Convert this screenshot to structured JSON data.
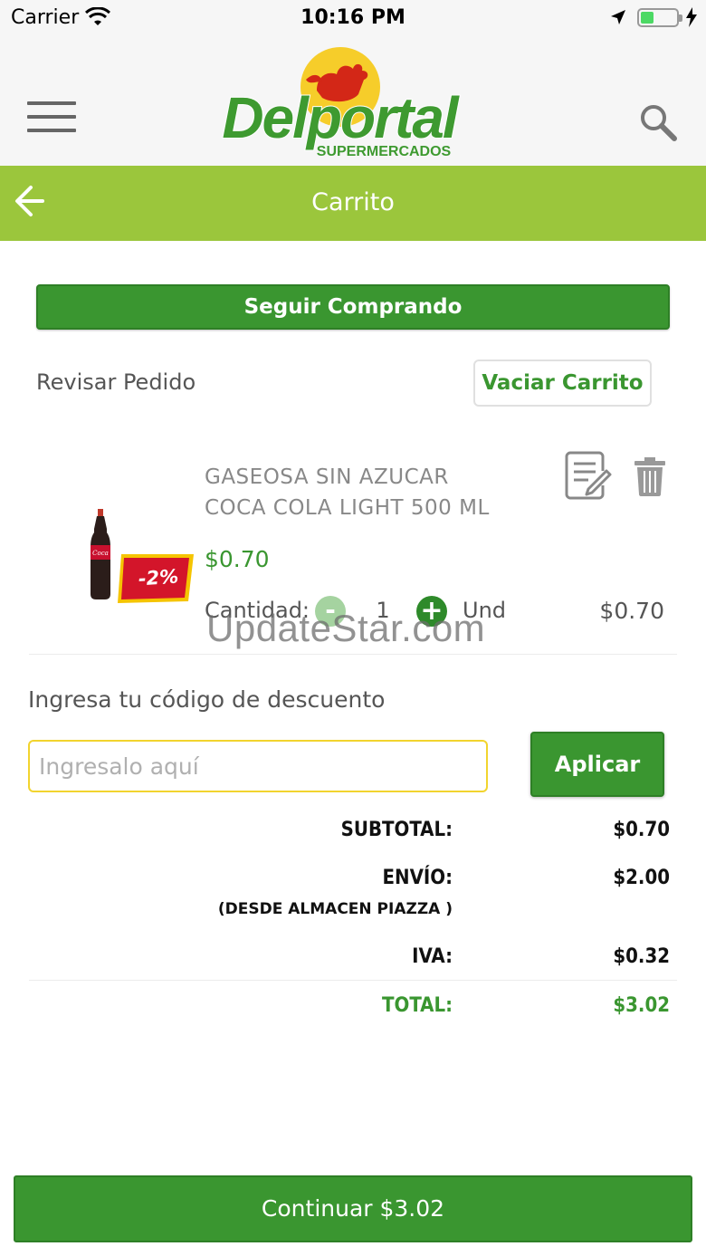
{
  "status_bar": {
    "carrier": "Carrier",
    "time": "10:16 PM"
  },
  "header": {
    "logo_text": "Delportal",
    "logo_subtext": "SUPERMERCADOS",
    "title": "Carrito"
  },
  "actions": {
    "continue_shopping": "Seguir Comprando",
    "review_label": "Revisar Pedido",
    "empty_cart": "Vaciar Carrito"
  },
  "product": {
    "name_line1": "GASEOSA SIN AZUCAR",
    "name_line2": "COCA COLA LIGHT 500 ML",
    "discount_badge": "-2%",
    "price": "$0.70",
    "qty_label": "Cantidad:",
    "qty_minus": "-",
    "quantity": "1",
    "qty_plus": "+",
    "unit": "Und",
    "line_total": "$0.70"
  },
  "watermark": "UpdateStar.com",
  "discount": {
    "label": "Ingresa tu código de descuento",
    "placeholder": "Ingresalo aquí",
    "value": "",
    "apply": "Aplicar"
  },
  "totals": {
    "subtotal_label": "SUBTOTAL:",
    "subtotal_value": "$0.70",
    "shipping_label": "ENVÍO:",
    "shipping_value": "$2.00",
    "shipping_note": "(DESDE ALMACEN PIAZZA )",
    "tax_label": "IVA:",
    "tax_value": "$0.32",
    "total_label": "TOTAL:",
    "total_value": "$3.02"
  },
  "footer": {
    "continue": "Continuar $3.02"
  },
  "colors": {
    "brand_green": "#3a9630",
    "bar_green": "#9bc63c",
    "input_border": "#f2d42e"
  }
}
